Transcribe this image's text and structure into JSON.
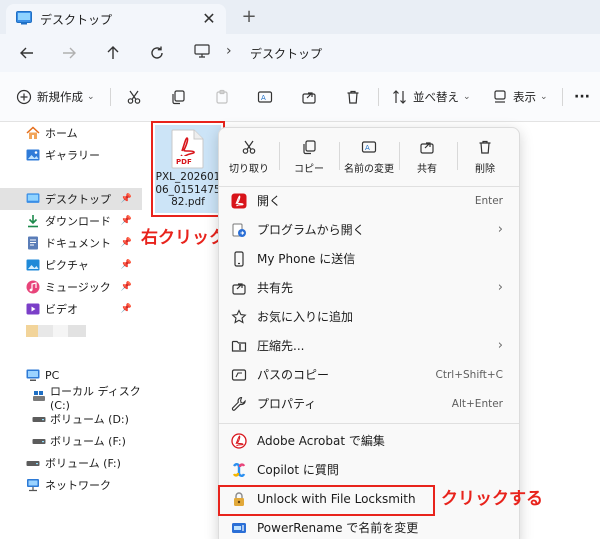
{
  "window": {
    "tab_title": "デスクトップ",
    "close_glyph": "✕",
    "new_tab_glyph": "+"
  },
  "nav": {
    "breadcrumb_sep": "›",
    "location": "デスクトップ"
  },
  "toolbar": {
    "new_label": "新規作成",
    "sort_label": "並べ替え",
    "view_label": "表示",
    "more_glyph": "···",
    "dropdown_glyph": "⌄"
  },
  "sidebar": {
    "items": [
      {
        "label": "ホーム",
        "icon": "home-icon"
      },
      {
        "label": "ギャラリー",
        "icon": "gallery-icon"
      },
      {
        "label": "デスクトップ",
        "icon": "desktop-icon",
        "pinned": true,
        "selected": true
      },
      {
        "label": "ダウンロード",
        "icon": "download-icon",
        "pinned": true
      },
      {
        "label": "ドキュメント",
        "icon": "documents-icon",
        "pinned": true
      },
      {
        "label": "ピクチャ",
        "icon": "pictures-icon",
        "pinned": true
      },
      {
        "label": "ミュージック",
        "icon": "music-icon",
        "pinned": true
      },
      {
        "label": "ビデオ",
        "icon": "video-icon",
        "pinned": true
      },
      {
        "label": "PC",
        "icon": "pc-icon"
      },
      {
        "label": "ローカル ディスク (C:)",
        "icon": "disk-icon"
      },
      {
        "label": "ボリューム (D:)",
        "icon": "drive-icon"
      },
      {
        "label": "ボリューム (F:)",
        "icon": "drive-icon"
      },
      {
        "label": "ボリューム (F:)",
        "icon": "drive-icon"
      },
      {
        "label": "ネットワーク",
        "icon": "network-icon"
      }
    ],
    "pin_glyph": "📌"
  },
  "file": {
    "name_line1": "PXL_202601",
    "name_line2": "06_0151475",
    "name_line3": "82.pdf",
    "badge": "PDF"
  },
  "annotations": {
    "right_click": "右クリック",
    "click": "クリックする",
    "color": "#e8231c"
  },
  "context_menu": {
    "top_commands": [
      {
        "label": "切り取り",
        "icon": "cut-icon"
      },
      {
        "label": "コピー",
        "icon": "copy-icon"
      },
      {
        "label": "名前の変更",
        "icon": "rename-icon"
      },
      {
        "label": "共有",
        "icon": "share-icon"
      },
      {
        "label": "削除",
        "icon": "delete-icon"
      }
    ],
    "items": [
      {
        "label": "開く",
        "shortcut": "Enter",
        "icon": "acrobat-icon"
      },
      {
        "label": "プログラムから開く",
        "submenu": true,
        "icon": "open-with-icon"
      },
      {
        "label": "My Phone に送信",
        "icon": "phone-icon"
      },
      {
        "label": "共有先",
        "submenu": true,
        "icon": "share-icon"
      },
      {
        "label": "お気に入りに追加",
        "icon": "star-icon"
      },
      {
        "label": "圧縮先...",
        "submenu": true,
        "icon": "archive-icon"
      },
      {
        "label": "パスのコピー",
        "shortcut": "Ctrl+Shift+C",
        "icon": "copy-path-icon"
      },
      {
        "label": "プロパティ",
        "shortcut": "Alt+Enter",
        "icon": "wrench-icon"
      },
      {
        "label": "Adobe Acrobat で編集",
        "icon": "acrobat-edit-icon"
      },
      {
        "label": "Copilot に質問",
        "icon": "copilot-icon"
      },
      {
        "label": "Unlock with File Locksmith",
        "icon": "lock-icon"
      },
      {
        "label": "PowerRename で名前を変更",
        "icon": "powerrename-icon"
      }
    ],
    "chevron_glyph": "›"
  }
}
